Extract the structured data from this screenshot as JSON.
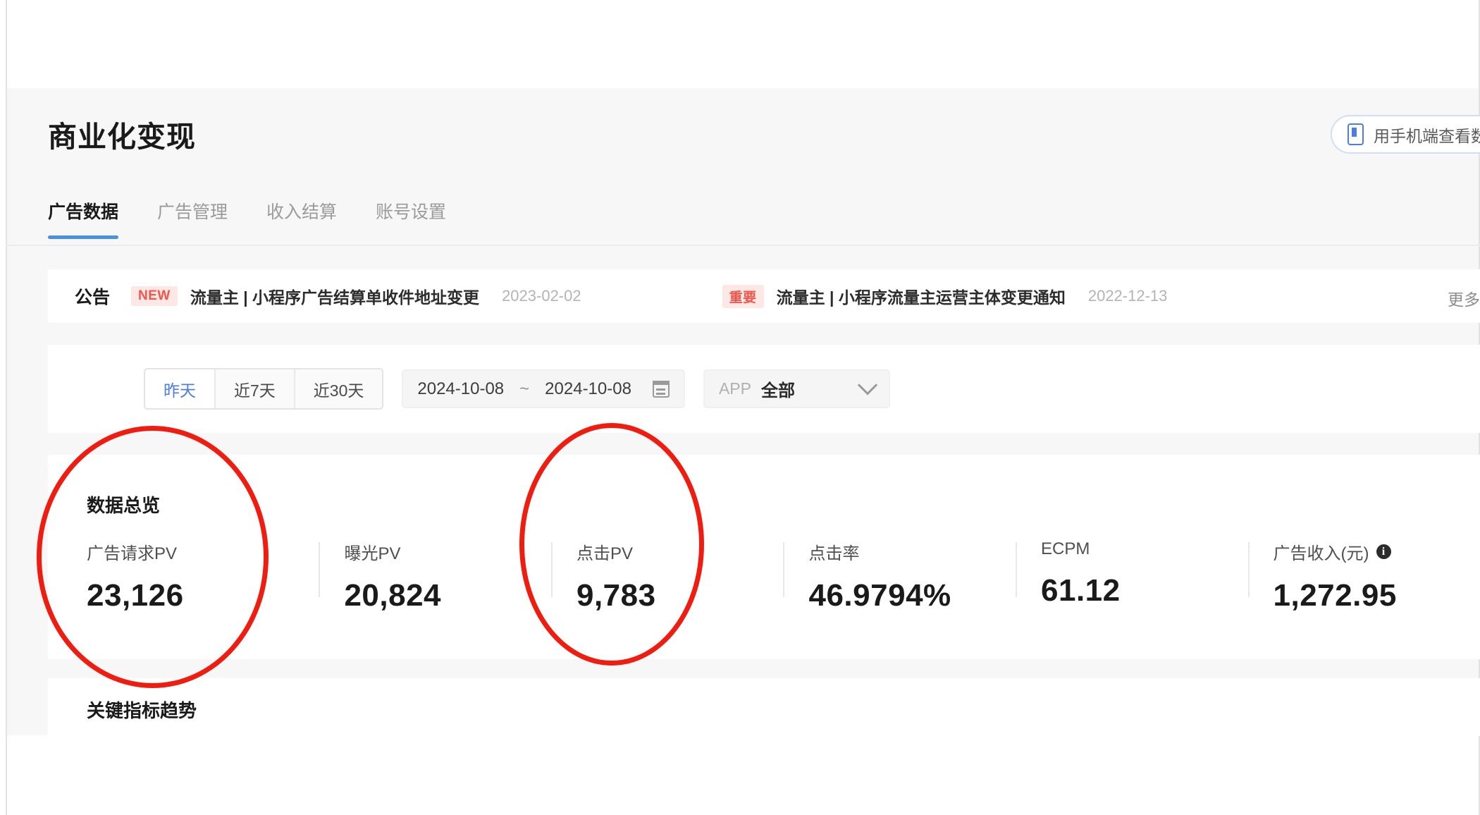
{
  "header": {
    "title": "商业化变现",
    "phone_button": {
      "label": "用手机端查看数",
      "icon": "phone-icon"
    }
  },
  "tabs": [
    {
      "label": "广告数据",
      "active": true
    },
    {
      "label": "广告管理",
      "active": false
    },
    {
      "label": "收入结算",
      "active": false
    },
    {
      "label": "账号设置",
      "active": false
    }
  ],
  "announcement": {
    "label": "公告",
    "more": "更多",
    "items": [
      {
        "badge": "NEW",
        "badge_color": "#f5544a",
        "text": "流量主 | 小程序广告结算单收件地址变更",
        "date": "2023-02-02"
      },
      {
        "badge": "重要",
        "badge_color": "#f5544a",
        "text": "流量主 | 小程序流量主运营主体变更通知",
        "date": "2022-12-13"
      }
    ]
  },
  "filters": {
    "range_presets": [
      {
        "label": "昨天",
        "active": true
      },
      {
        "label": "近7天",
        "active": false
      },
      {
        "label": "近30天",
        "active": false
      }
    ],
    "date_range": {
      "start": "2024-10-08",
      "separator": "~",
      "end": "2024-10-08",
      "icon": "calendar-icon"
    },
    "app_select": {
      "label": "APP",
      "value": "全部",
      "icon": "chevron-down-icon"
    }
  },
  "overview": {
    "title": "数据总览",
    "metrics": [
      {
        "label": "广告请求PV",
        "value": "23,126",
        "info": false
      },
      {
        "label": "曝光PV",
        "value": "20,824",
        "info": false
      },
      {
        "label": "点击PV",
        "value": "9,783",
        "info": false
      },
      {
        "label": "点击率",
        "value": "46.9794%",
        "info": false
      },
      {
        "label": "ECPM",
        "value": "61.12",
        "info": false
      },
      {
        "label": "广告收入(元)",
        "value": "1,272.95",
        "info": true,
        "info_glyph": "i"
      }
    ]
  },
  "trend": {
    "title": "关键指标趋势"
  },
  "annotations": {
    "color": "#f01c10",
    "shapes": [
      {
        "id": "annot-1",
        "type": "ellipse",
        "targets": "数据总览 / 广告请求PV 23,126"
      },
      {
        "id": "annot-2",
        "type": "ellipse",
        "targets": "点击PV 9,783"
      }
    ]
  }
}
